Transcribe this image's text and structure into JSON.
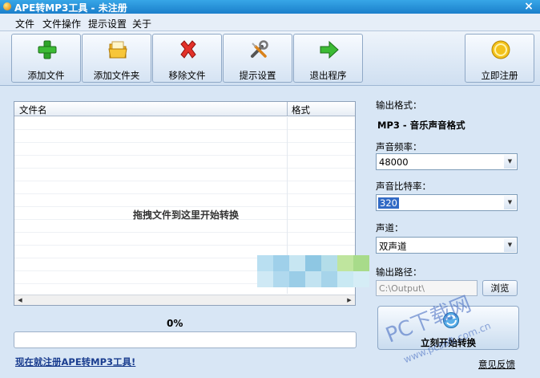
{
  "window": {
    "title": "APE转MP3工具 - 未注册",
    "close_glyph": "×"
  },
  "menu": {
    "items": [
      {
        "label": "文件"
      },
      {
        "label": "文件操作"
      },
      {
        "label": "提示设置"
      },
      {
        "label": "关于"
      }
    ]
  },
  "toolbar": {
    "add_file": "添加文件",
    "add_folder": "添加文件夹",
    "remove_file": "移除文件",
    "settings": "提示设置",
    "exit": "退出程序",
    "register": "立即注册"
  },
  "file_list": {
    "columns": {
      "name": "文件名",
      "format": "格式"
    },
    "drop_hint": "拖拽文件到这里开始转换",
    "rows": []
  },
  "progress": {
    "text": "0%",
    "value": 0
  },
  "register_link": "现在就注册APE转MP3工具!",
  "settings": {
    "output_format_label": "输出格式：",
    "output_format_value": "MP3 - 音乐声音格式",
    "sample_rate_label": "声音频率：",
    "sample_rate_value": "48000",
    "bitrate_label": "声音比特率：",
    "bitrate_value": "320",
    "channel_label": "声道：",
    "channel_value": "双声道",
    "output_path_label": "输出路径：",
    "output_path_value": "C:\\Output\\",
    "browse_label": "浏览"
  },
  "convert_button": "立刻开始转换",
  "feedback_link": "意见反馈",
  "watermark": {
    "text": "PC下载网",
    "url": "www.pcsoft.com.cn"
  },
  "colors": {
    "titlebar": "#1b7fcb",
    "window_bg": "#d8e6f5",
    "link": "#1a3d8f",
    "selection": "#316ac5"
  }
}
